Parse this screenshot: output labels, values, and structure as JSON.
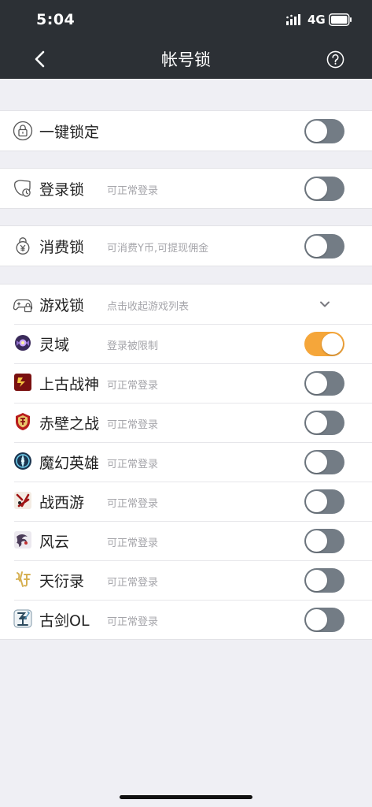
{
  "status": {
    "time": "5:04",
    "network": "4G"
  },
  "nav": {
    "title": "帐号锁"
  },
  "one_key": {
    "label": "一键锁定",
    "on": false
  },
  "login_lock": {
    "label": "登录锁",
    "sub": "可正常登录",
    "on": false
  },
  "spend_lock": {
    "label": "消费锁",
    "sub": "可消费Y币,可提现佣金",
    "on": false
  },
  "game_lock": {
    "label": "游戏锁",
    "sub": "点击收起游戏列表"
  },
  "games": [
    {
      "name": "灵域",
      "status": "登录被限制",
      "on": true
    },
    {
      "name": "上古战神",
      "status": "可正常登录",
      "on": false
    },
    {
      "name": "赤壁之战",
      "status": "可正常登录",
      "on": false
    },
    {
      "name": "魔幻英雄",
      "status": "可正常登录",
      "on": false
    },
    {
      "name": "战西游",
      "status": "可正常登录",
      "on": false
    },
    {
      "name": "风云",
      "status": "可正常登录",
      "on": false
    },
    {
      "name": "天衍录",
      "status": "可正常登录",
      "on": false
    },
    {
      "name": "古剑OL",
      "status": "可正常登录",
      "on": false
    }
  ],
  "colors": {
    "accent": "#f5a63a",
    "toggle_off": "#737c85",
    "header": "#2c3035"
  }
}
